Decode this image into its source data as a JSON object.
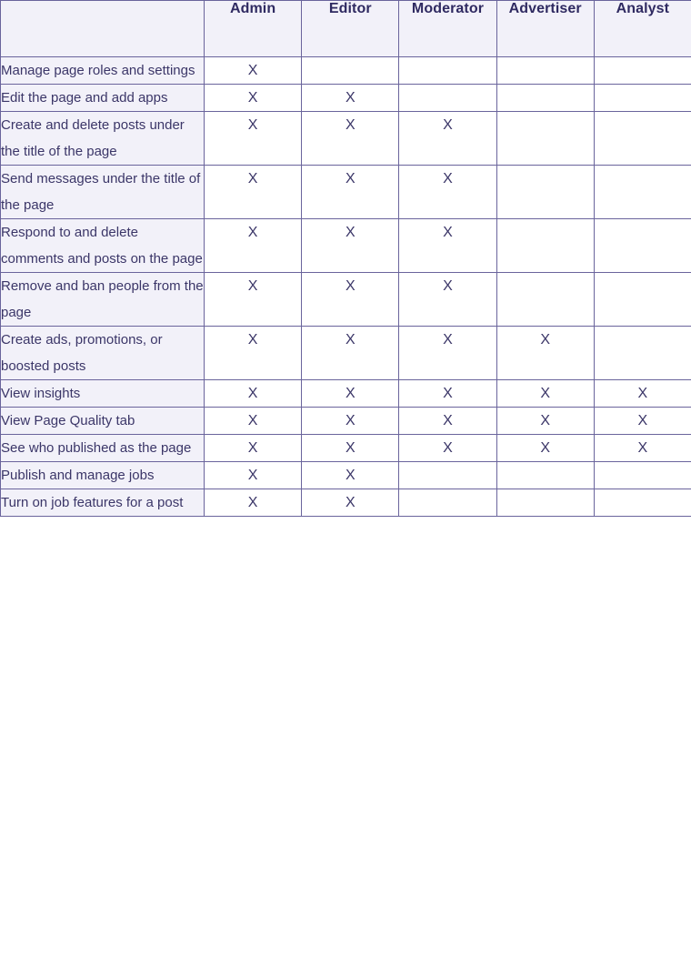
{
  "table": {
    "name": "page-roles-permissions-table",
    "corner_label": "",
    "columns": [
      {
        "key": "task",
        "label": ""
      },
      {
        "key": "admin",
        "label": "Admin"
      },
      {
        "key": "editor",
        "label": "Editor"
      },
      {
        "key": "moderator",
        "label": "Moderator"
      },
      {
        "key": "advertiser",
        "label": "Advertiser"
      },
      {
        "key": "analyst",
        "label": "Analyst"
      }
    ],
    "mark_symbol": "X",
    "colors": {
      "border": "#6a649c",
      "header_background": "#f2f1f9",
      "task_column_background": "#f2f1f9",
      "cell_background": "#ffffff",
      "header_text": "#2f2a61",
      "body_text": "#3b3668"
    },
    "rows": [
      {
        "task": "Manage page roles and settings",
        "admin": "X",
        "editor": "",
        "moderator": "",
        "advertiser": "",
        "analyst": ""
      },
      {
        "task": "Edit the page and add apps",
        "admin": "X",
        "editor": "X",
        "moderator": "",
        "advertiser": "",
        "analyst": ""
      },
      {
        "task": "Create and delete posts under the title of the page",
        "admin": "X",
        "editor": "X",
        "moderator": "X",
        "advertiser": "",
        "analyst": ""
      },
      {
        "task": "Send messages under the title of the page",
        "admin": "X",
        "editor": "X",
        "moderator": "X",
        "advertiser": "",
        "analyst": ""
      },
      {
        "task": "Respond to and delete comments and posts on the page",
        "admin": "X",
        "editor": "X",
        "moderator": "X",
        "advertiser": "",
        "analyst": ""
      },
      {
        "task": "Remove and ban people from the page",
        "admin": "X",
        "editor": "X",
        "moderator": "X",
        "advertiser": "",
        "analyst": ""
      },
      {
        "task": "Create ads, promotions, or boosted posts",
        "admin": "X",
        "editor": "X",
        "moderator": "X",
        "advertiser": "X",
        "analyst": ""
      },
      {
        "task": "View insights",
        "admin": "X",
        "editor": "X",
        "moderator": "X",
        "advertiser": "X",
        "analyst": "X"
      },
      {
        "task": "View Page Quality tab",
        "admin": "X",
        "editor": "X",
        "moderator": "X",
        "advertiser": "X",
        "analyst": "X"
      },
      {
        "task": "See who published as the page",
        "admin": "X",
        "editor": "X",
        "moderator": "X",
        "advertiser": "X",
        "analyst": "X"
      },
      {
        "task": "Publish and manage jobs",
        "admin": "X",
        "editor": "X",
        "moderator": "",
        "advertiser": "",
        "analyst": ""
      },
      {
        "task": "Turn on job features for a post",
        "admin": "X",
        "editor": "X",
        "moderator": "",
        "advertiser": "",
        "analyst": ""
      }
    ]
  }
}
